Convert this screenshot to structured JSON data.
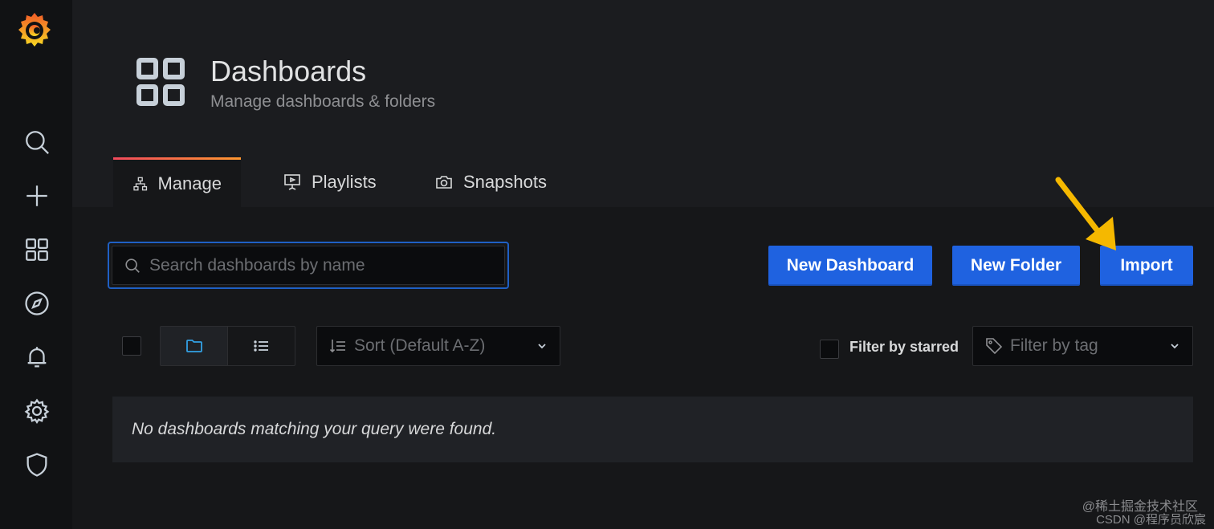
{
  "sidebar": {
    "items": [
      {
        "name": "search",
        "icon": "search-icon"
      },
      {
        "name": "create",
        "icon": "plus-icon"
      },
      {
        "name": "dashboards",
        "icon": "dashboards-icon"
      },
      {
        "name": "explore",
        "icon": "compass-icon"
      },
      {
        "name": "alerting",
        "icon": "bell-icon"
      },
      {
        "name": "configuration",
        "icon": "gear-icon"
      },
      {
        "name": "server-admin",
        "icon": "shield-icon"
      }
    ]
  },
  "header": {
    "title": "Dashboards",
    "subtitle": "Manage dashboards & folders",
    "icon": "dashboards-icon"
  },
  "tabs": [
    {
      "label": "Manage",
      "icon": "sitemap-icon",
      "active": true
    },
    {
      "label": "Playlists",
      "icon": "presentation-icon",
      "active": false
    },
    {
      "label": "Snapshots",
      "icon": "camera-icon",
      "active": false
    }
  ],
  "search": {
    "placeholder": "Search dashboards by name",
    "value": ""
  },
  "actions": {
    "new_dashboard": "New Dashboard",
    "new_folder": "New Folder",
    "import": "Import"
  },
  "filters": {
    "sort_placeholder": "Sort (Default A-Z)",
    "starred_label": "Filter by starred",
    "tag_placeholder": "Filter by tag"
  },
  "empty_message": "No dashboards matching your query were found.",
  "watermark": {
    "line1": "@稀土掘金技术社区",
    "line2": "CSDN @程序员欣宸"
  },
  "colors": {
    "background": "#161719",
    "sidebar": "#111214",
    "primary_button": "#1f62e0",
    "search_focus": "#1f60c4",
    "annotation_arrow": "#f5b800"
  }
}
